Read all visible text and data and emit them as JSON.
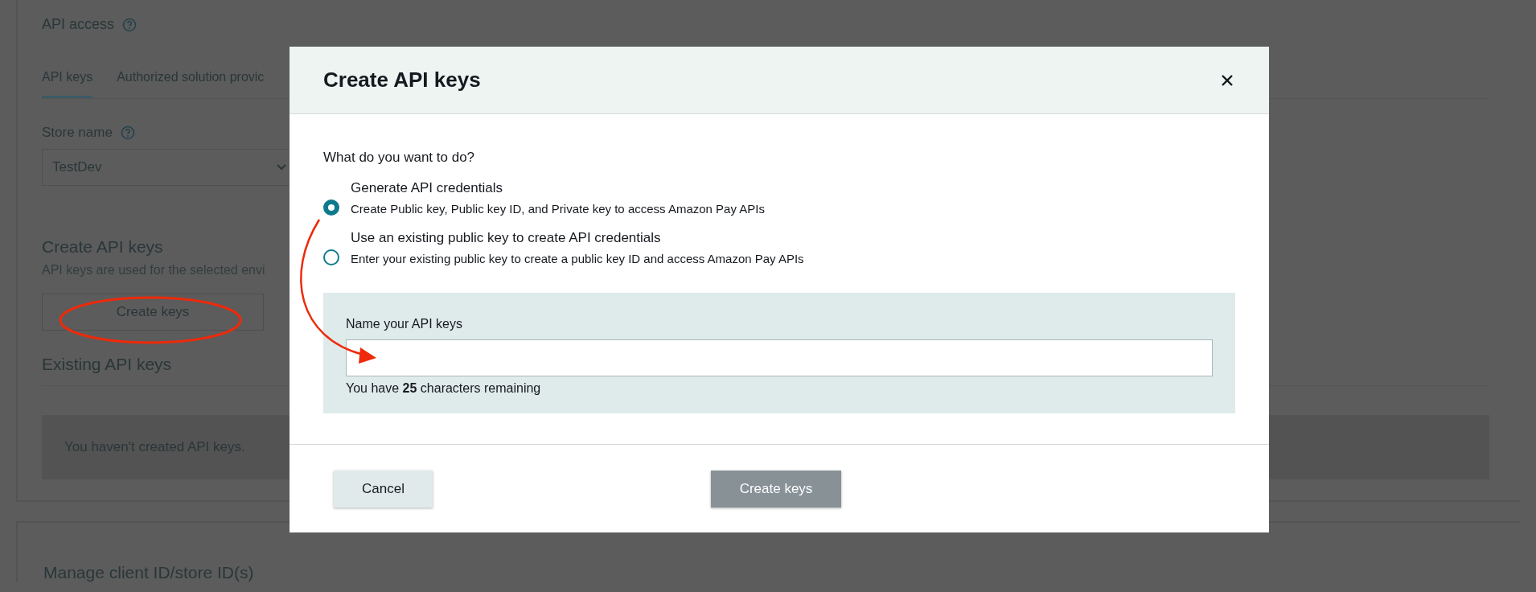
{
  "page": {
    "title": "API access",
    "tabs": [
      {
        "label": "API keys",
        "selected": true
      },
      {
        "label": "Authorized solution provic",
        "selected": false
      }
    ],
    "store": {
      "label": "Store name",
      "value": "TestDev"
    },
    "create_section": {
      "title": "Create API keys",
      "description": "API keys are used for the selected envi",
      "button": "Create keys"
    },
    "existing_section": {
      "title": "Existing API keys",
      "empty_message": "You haven't created API keys."
    },
    "manage_section": {
      "title": "Manage client ID/store ID(s)"
    }
  },
  "dialog": {
    "title": "Create API keys",
    "question": "What do you want to do?",
    "options": [
      {
        "title": "Generate API credentials",
        "description": "Create Public key, Public key ID, and Private key to access Amazon Pay APIs",
        "selected": true
      },
      {
        "title": "Use an existing public key to create API credentials",
        "description": "Enter your existing public key to create a public key ID and access Amazon Pay APIs",
        "selected": false
      }
    ],
    "name_field": {
      "label": "Name your API keys",
      "hint": "You have **25** characters remaining"
    },
    "buttons": [
      {
        "label": "Cancel",
        "kind": "secondary",
        "disabled": false
      },
      {
        "label": "Create keys",
        "kind": "primary",
        "disabled": true
      }
    ]
  }
}
